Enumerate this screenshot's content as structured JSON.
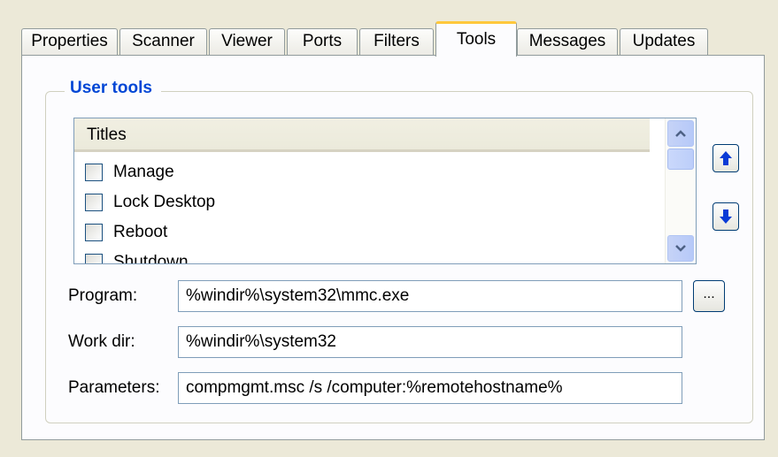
{
  "tabs": [
    {
      "label": "Properties"
    },
    {
      "label": "Scanner"
    },
    {
      "label": "Viewer"
    },
    {
      "label": "Ports"
    },
    {
      "label": "Filters"
    },
    {
      "label": "Tools",
      "active": true
    },
    {
      "label": "Messages"
    },
    {
      "label": "Updates"
    }
  ],
  "group": {
    "title": "User tools"
  },
  "list": {
    "header": "Titles",
    "items": [
      "Manage",
      "Lock Desktop",
      "Reboot",
      "Shutdown"
    ]
  },
  "form": {
    "program_label": "Program:",
    "program_value": "%windir%\\system32\\mmc.exe",
    "workdir_label": "Work dir:",
    "workdir_value": "%windir%\\system32",
    "parameters_label": "Parameters:",
    "parameters_value": "compmgmt.msc /s /computer:%remotehostname%",
    "browse_label": "..."
  },
  "colors": {
    "accent": "#0046d5",
    "active_tab_highlight": "#ffc83c",
    "arrow": "#0a3bd6"
  }
}
